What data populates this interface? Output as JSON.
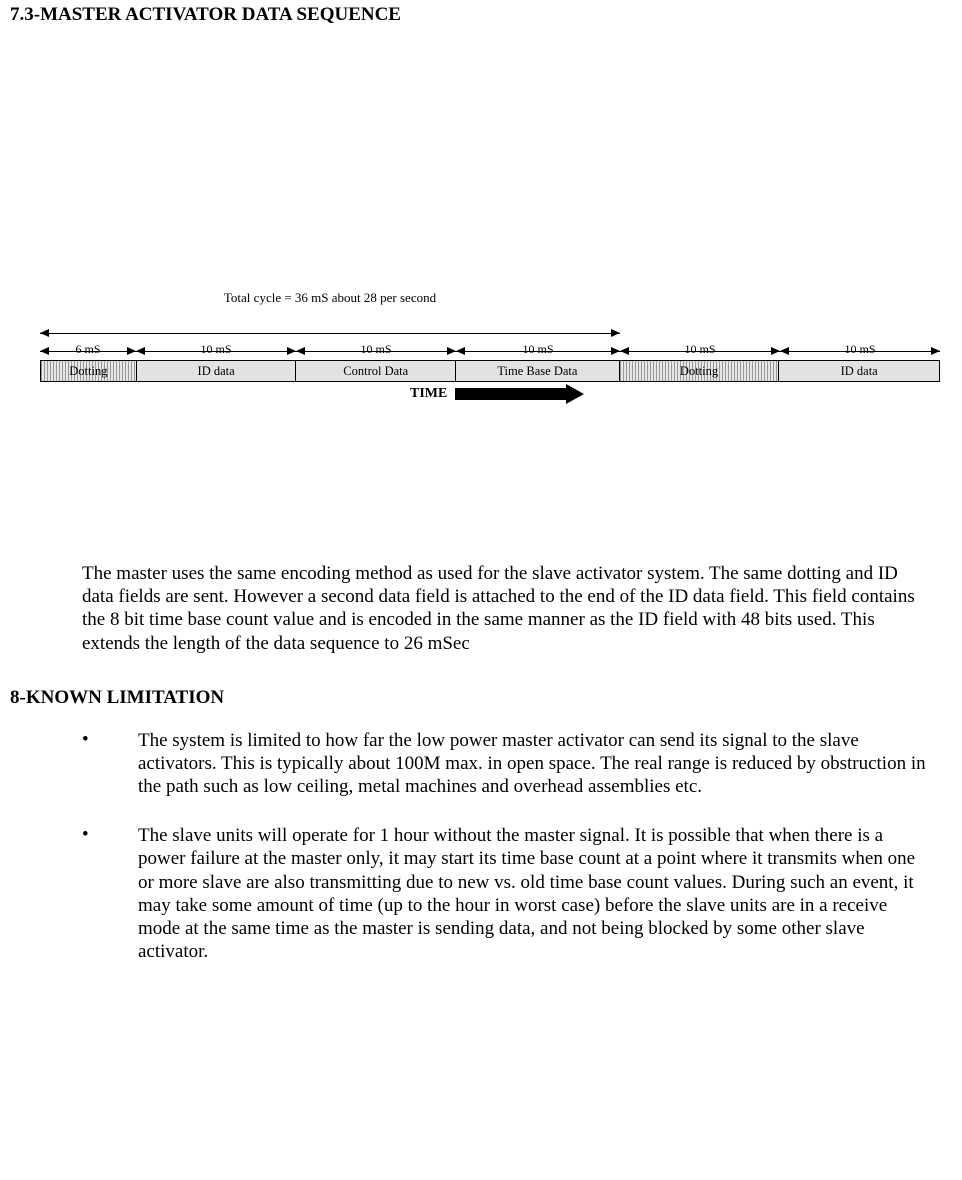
{
  "headings": {
    "h73": "7.3-MASTER ACTIVATOR DATA SEQUENCE",
    "h8": "8-KNOWN LIMITATION"
  },
  "diagram": {
    "total_label": "Total cycle = 36 mS about 28 per second",
    "durations": [
      "6 mS",
      "10 mS",
      "10 mS",
      "10 mS",
      "10 mS",
      "10 mS"
    ],
    "segments": [
      "Dotting",
      "ID data",
      "Control Data",
      "Time Base Data",
      "Dotting",
      "ID data"
    ],
    "time_label": "TIME"
  },
  "chart_data": {
    "type": "table",
    "title": "Master Activator Data Sequence timing",
    "total_cycle_ms": 36,
    "cycles_per_second": 28,
    "segments": [
      {
        "name": "Dotting",
        "duration_ms": 6
      },
      {
        "name": "ID data",
        "duration_ms": 10
      },
      {
        "name": "Control Data",
        "duration_ms": 10
      },
      {
        "name": "Time Base Data",
        "duration_ms": 10
      },
      {
        "name": "Dotting",
        "duration_ms": 10
      },
      {
        "name": "ID data",
        "duration_ms": 10
      }
    ]
  },
  "paragraph": "The master uses the same encoding method as used for the slave activator system.  The same dotting and ID data fields are sent.  However a second data field is attached to the end of the ID data field.  This field contains the 8 bit time base count value and is encoded in the same manner as the ID field with 48 bits used.  This extends the length of the data sequence to 26 mSec",
  "bullets": [
    "The system is limited to how far the low power master activator can send its signal to the slave activators.  This is typically about 100M max. in open space.  The real range is reduced by obstruction in the path such as low ceiling, metal machines and overhead assemblies etc.",
    "The slave units will operate for 1 hour without the master signal.  It is possible that when there is a power failure at the master only, it may start its time base count at a point where it transmits when one or more slave are also transmitting due to new vs. old time base count values.  During such an event, it may take some amount of time (up to the hour in worst case) before the slave units are in a receive mode at the same time as the master is sending data, and not being blocked by some other slave activator."
  ]
}
